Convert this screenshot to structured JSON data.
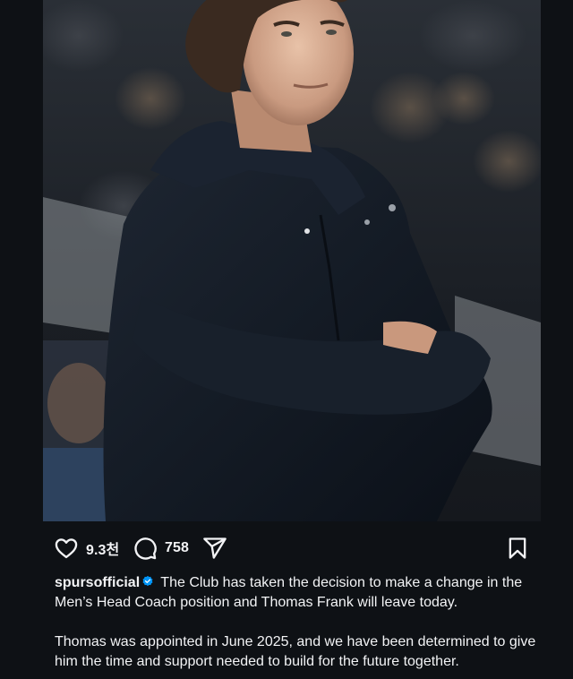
{
  "post": {
    "likes": "9.3천",
    "comments": "758",
    "username": "spursofficial",
    "caption_line1": "The Club has taken the decision to make a change in the Men’s Head Coach position and Thomas Frank will leave today.",
    "caption_line2": "Thomas was appointed in June 2025, and we have been determined to give him the time and support needed to build for the future together."
  },
  "icons": {
    "like": "heart-icon",
    "comment": "comment-bubble-icon",
    "share": "paper-plane-icon",
    "save": "bookmark-icon",
    "verified": "verified-badge-icon"
  },
  "colors": {
    "background": "#0e1115",
    "text": "#f2f3f5",
    "verified_badge": "#0095f6"
  }
}
